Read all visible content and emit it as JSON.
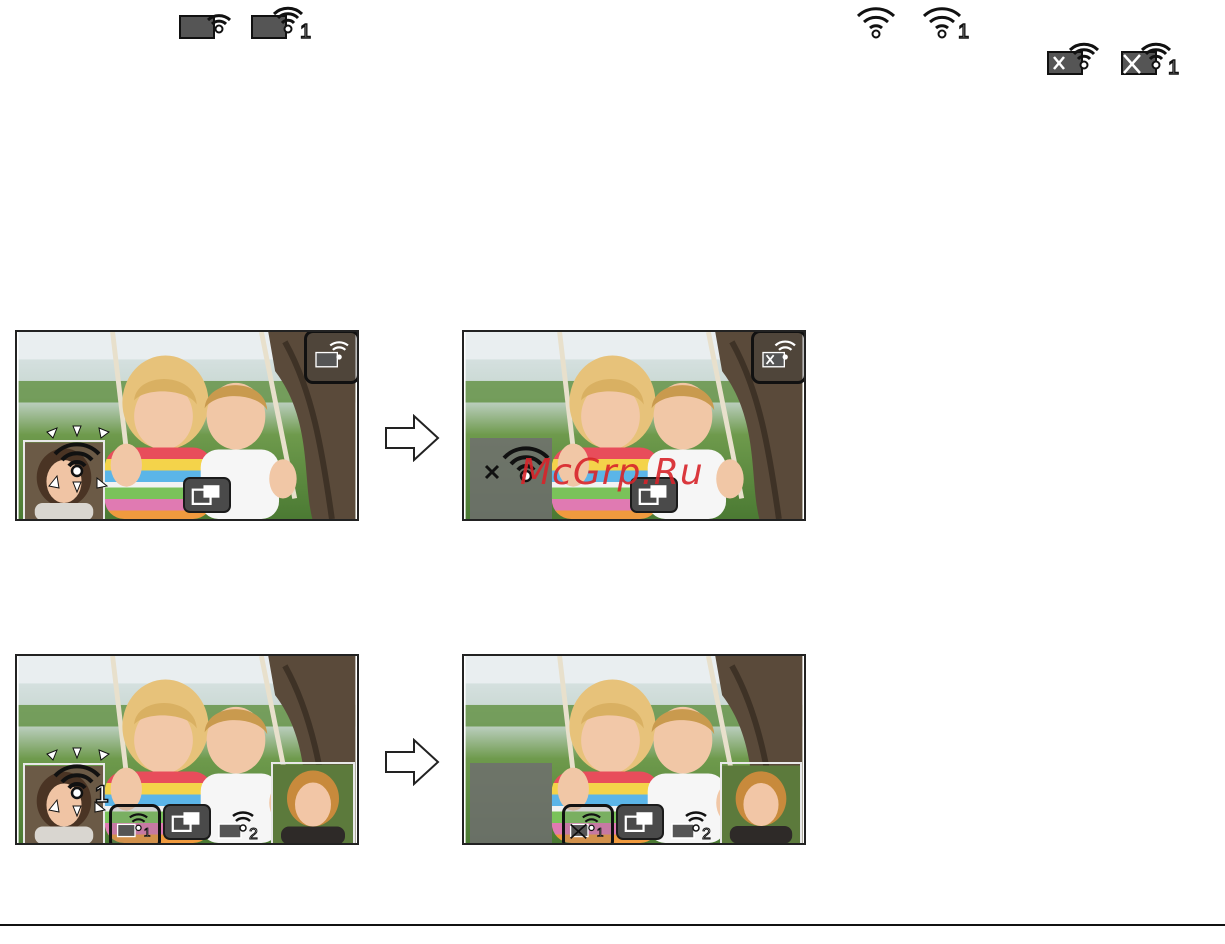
{
  "legend": {
    "icons": [
      {
        "name": "camera-wifi-icon",
        "sub": ""
      },
      {
        "name": "camera-wifi-icon",
        "sub": "1"
      },
      {
        "name": "wifi-icon",
        "sub": ""
      },
      {
        "name": "wifi-icon",
        "sub": "1"
      },
      {
        "name": "camera-wifi-disconnected-icon",
        "sub": ""
      },
      {
        "name": "camera-wifi-disconnected-icon",
        "sub": "1"
      }
    ]
  },
  "panels": {
    "row1_left": {
      "wifi_badge": "camera-wifi-icon",
      "pip": "wifi-connecting-icon"
    },
    "row1_right": {
      "wifi_badge": "camera-wifi-disconnected-icon",
      "pip": "wifi-disconnected-icon"
    },
    "row2_left": {
      "badge_1_sub": "1",
      "badge_2_sub": "2",
      "pip_sub": "1"
    },
    "row2_right": {
      "badge_1_sub": "1",
      "badge_2_sub": "2"
    }
  },
  "arrows": [
    "right-arrow-icon",
    "right-arrow-icon"
  ],
  "watermark": "McGrp.Ru",
  "colors": {
    "ink": "#111111",
    "watermark": "#d8242a",
    "icon_fill": "#4a4a4a"
  }
}
